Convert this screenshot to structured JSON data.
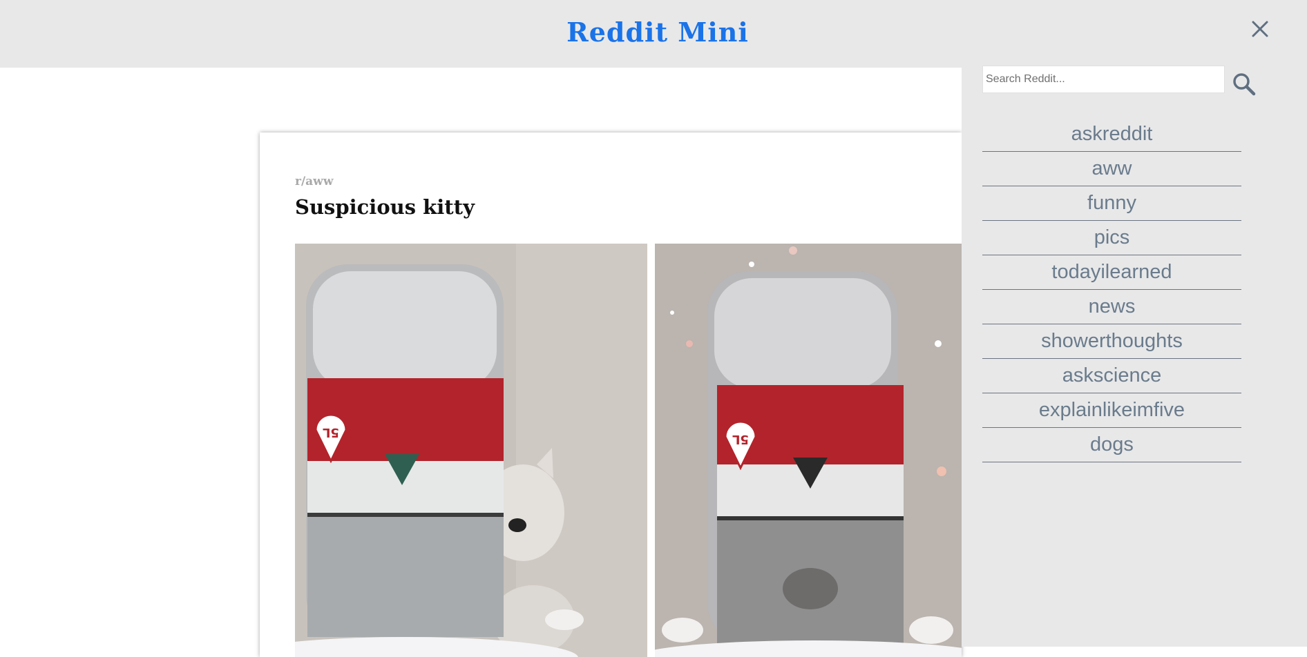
{
  "header": {
    "title": "Reddit Mini",
    "close_icon": "close-icon"
  },
  "post": {
    "subreddit": "r/aww",
    "title": "Suspicious kitty",
    "images": [
      {
        "subject": "cat peeking behind water bottle"
      },
      {
        "subject": "cat behind water bottle"
      }
    ]
  },
  "search": {
    "placeholder": "Search Reddit...",
    "value": "",
    "icon": "search-icon"
  },
  "subreddits": [
    {
      "label": "askreddit"
    },
    {
      "label": "aww"
    },
    {
      "label": "funny"
    },
    {
      "label": "pics"
    },
    {
      "label": "todayilearned"
    },
    {
      "label": "news"
    },
    {
      "label": "showerthoughts"
    },
    {
      "label": "askscience"
    },
    {
      "label": "explainlikeimfive"
    },
    {
      "label": "dogs"
    }
  ],
  "colors": {
    "accent": "#1a73e8",
    "header_bg": "#e8e8e9",
    "link": "#6a7b8c",
    "subreddit_label": "#a9a9a9"
  }
}
